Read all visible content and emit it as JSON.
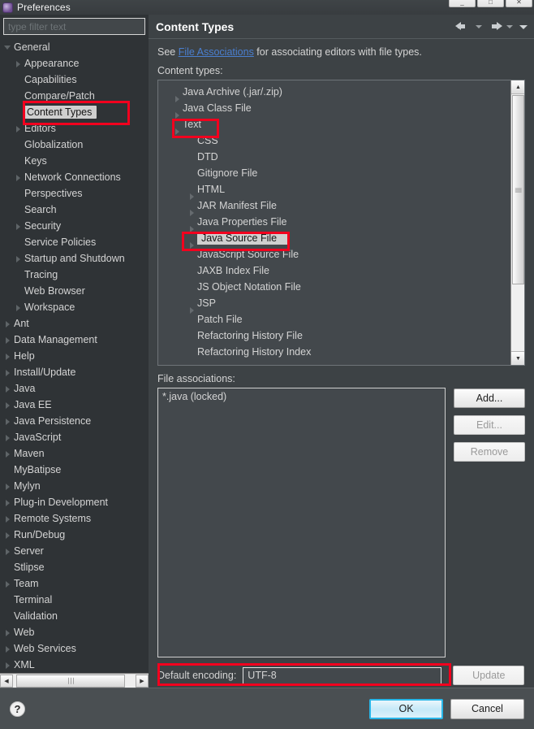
{
  "window": {
    "title": "Preferences",
    "icon": "app-icon",
    "controls": [
      "minimize",
      "maximize",
      "close"
    ]
  },
  "sidebar": {
    "filter": {
      "placeholder": "type filter text",
      "value": ""
    },
    "items": [
      {
        "label": "General",
        "indent": 0,
        "expander": "open",
        "selected": false
      },
      {
        "label": "Appearance",
        "indent": 1,
        "expander": "closed",
        "selected": false
      },
      {
        "label": "Capabilities",
        "indent": 1,
        "expander": "none",
        "selected": false
      },
      {
        "label": "Compare/Patch",
        "indent": 1,
        "expander": "none",
        "selected": false
      },
      {
        "label": "Content Types",
        "indent": 1,
        "expander": "none",
        "selected": true
      },
      {
        "label": "Editors",
        "indent": 1,
        "expander": "closed",
        "selected": false
      },
      {
        "label": "Globalization",
        "indent": 1,
        "expander": "none",
        "selected": false
      },
      {
        "label": "Keys",
        "indent": 1,
        "expander": "none",
        "selected": false
      },
      {
        "label": "Network Connections",
        "indent": 1,
        "expander": "closed",
        "selected": false
      },
      {
        "label": "Perspectives",
        "indent": 1,
        "expander": "none",
        "selected": false
      },
      {
        "label": "Search",
        "indent": 1,
        "expander": "none",
        "selected": false
      },
      {
        "label": "Security",
        "indent": 1,
        "expander": "closed",
        "selected": false
      },
      {
        "label": "Service Policies",
        "indent": 1,
        "expander": "none",
        "selected": false
      },
      {
        "label": "Startup and Shutdown",
        "indent": 1,
        "expander": "closed",
        "selected": false
      },
      {
        "label": "Tracing",
        "indent": 1,
        "expander": "none",
        "selected": false
      },
      {
        "label": "Web Browser",
        "indent": 1,
        "expander": "none",
        "selected": false
      },
      {
        "label": "Workspace",
        "indent": 1,
        "expander": "closed",
        "selected": false
      },
      {
        "label": "Ant",
        "indent": 0,
        "expander": "closed",
        "selected": false
      },
      {
        "label": "Data Management",
        "indent": 0,
        "expander": "closed",
        "selected": false
      },
      {
        "label": "Help",
        "indent": 0,
        "expander": "closed",
        "selected": false
      },
      {
        "label": "Install/Update",
        "indent": 0,
        "expander": "closed",
        "selected": false
      },
      {
        "label": "Java",
        "indent": 0,
        "expander": "closed",
        "selected": false
      },
      {
        "label": "Java EE",
        "indent": 0,
        "expander": "closed",
        "selected": false
      },
      {
        "label": "Java Persistence",
        "indent": 0,
        "expander": "closed",
        "selected": false
      },
      {
        "label": "JavaScript",
        "indent": 0,
        "expander": "closed",
        "selected": false
      },
      {
        "label": "Maven",
        "indent": 0,
        "expander": "closed",
        "selected": false
      },
      {
        "label": "MyBatipse",
        "indent": 0,
        "expander": "none",
        "selected": false
      },
      {
        "label": "Mylyn",
        "indent": 0,
        "expander": "closed",
        "selected": false
      },
      {
        "label": "Plug-in Development",
        "indent": 0,
        "expander": "closed",
        "selected": false
      },
      {
        "label": "Remote Systems",
        "indent": 0,
        "expander": "closed",
        "selected": false
      },
      {
        "label": "Run/Debug",
        "indent": 0,
        "expander": "closed",
        "selected": false
      },
      {
        "label": "Server",
        "indent": 0,
        "expander": "closed",
        "selected": false
      },
      {
        "label": "Stlipse",
        "indent": 0,
        "expander": "none",
        "selected": false
      },
      {
        "label": "Team",
        "indent": 0,
        "expander": "closed",
        "selected": false
      },
      {
        "label": "Terminal",
        "indent": 0,
        "expander": "none",
        "selected": false
      },
      {
        "label": "Validation",
        "indent": 0,
        "expander": "none",
        "selected": false
      },
      {
        "label": "Web",
        "indent": 0,
        "expander": "closed",
        "selected": false
      },
      {
        "label": "Web Services",
        "indent": 0,
        "expander": "closed",
        "selected": false
      },
      {
        "label": "XML",
        "indent": 0,
        "expander": "closed",
        "selected": false
      }
    ],
    "hscrollbar": {
      "left_arrow": "◀",
      "right_arrow": "▶",
      "grip": "∣∣∣"
    }
  },
  "page": {
    "title": "Content Types",
    "nav": {
      "back": "back-arrow",
      "back_menu": "chevron-down",
      "forward": "forward-arrow",
      "forward_menu": "chevron-down",
      "view_menu": "chevron-down"
    },
    "see_prefix": "See ",
    "see_link": "File Associations",
    "see_suffix": " for associating editors with file types.",
    "content_types_label": "Content types:",
    "content_types": [
      {
        "label": "Java Archive (.jar/.zip)",
        "indent": 1,
        "expander": "closed",
        "selected": false
      },
      {
        "label": "Java Class File",
        "indent": 1,
        "expander": "closed",
        "selected": false
      },
      {
        "label": "Text",
        "indent": 1,
        "expander": "closed",
        "selected": false
      },
      {
        "label": "CSS",
        "indent": 2,
        "expander": "none",
        "selected": false
      },
      {
        "label": "DTD",
        "indent": 2,
        "expander": "none",
        "selected": false
      },
      {
        "label": "Gitignore File",
        "indent": 2,
        "expander": "none",
        "selected": false
      },
      {
        "label": "HTML",
        "indent": 2,
        "expander": "closed",
        "selected": false
      },
      {
        "label": "JAR Manifest File",
        "indent": 2,
        "expander": "closed",
        "selected": false
      },
      {
        "label": "Java Properties File",
        "indent": 2,
        "expander": "closed",
        "selected": false
      },
      {
        "label": "Java Source File",
        "indent": 2,
        "expander": "closed",
        "selected": true
      },
      {
        "label": "JavaScript Source File",
        "indent": 2,
        "expander": "none",
        "selected": false
      },
      {
        "label": "JAXB Index File",
        "indent": 2,
        "expander": "none",
        "selected": false
      },
      {
        "label": "JS Object Notation File",
        "indent": 2,
        "expander": "none",
        "selected": false
      },
      {
        "label": "JSP",
        "indent": 2,
        "expander": "closed",
        "selected": false
      },
      {
        "label": "Patch File",
        "indent": 2,
        "expander": "none",
        "selected": false
      },
      {
        "label": "Refactoring History File",
        "indent": 2,
        "expander": "none",
        "selected": false
      },
      {
        "label": "Refactoring History Index",
        "indent": 2,
        "expander": "none",
        "selected": false
      }
    ],
    "scrollbar": {
      "up": "▲",
      "down": "▼"
    },
    "file_associations_label": "File associations:",
    "file_associations": [
      "*.java (locked)"
    ],
    "buttons": [
      {
        "label": "Add...",
        "enabled": true
      },
      {
        "label": "Edit...",
        "enabled": false
      },
      {
        "label": "Remove",
        "enabled": false
      }
    ],
    "encoding": {
      "label": "Default encoding:",
      "value": "UTF-8",
      "update_label": "Update",
      "update_enabled": false
    }
  },
  "footer": {
    "help_icon": "?",
    "ok_label": "OK",
    "cancel_label": "Cancel"
  },
  "annotations": {
    "color": "#f2001e",
    "boxes": [
      "content-types-sidebar-item",
      "text-content-type",
      "java-source-file-content-type",
      "default-encoding-row"
    ]
  }
}
